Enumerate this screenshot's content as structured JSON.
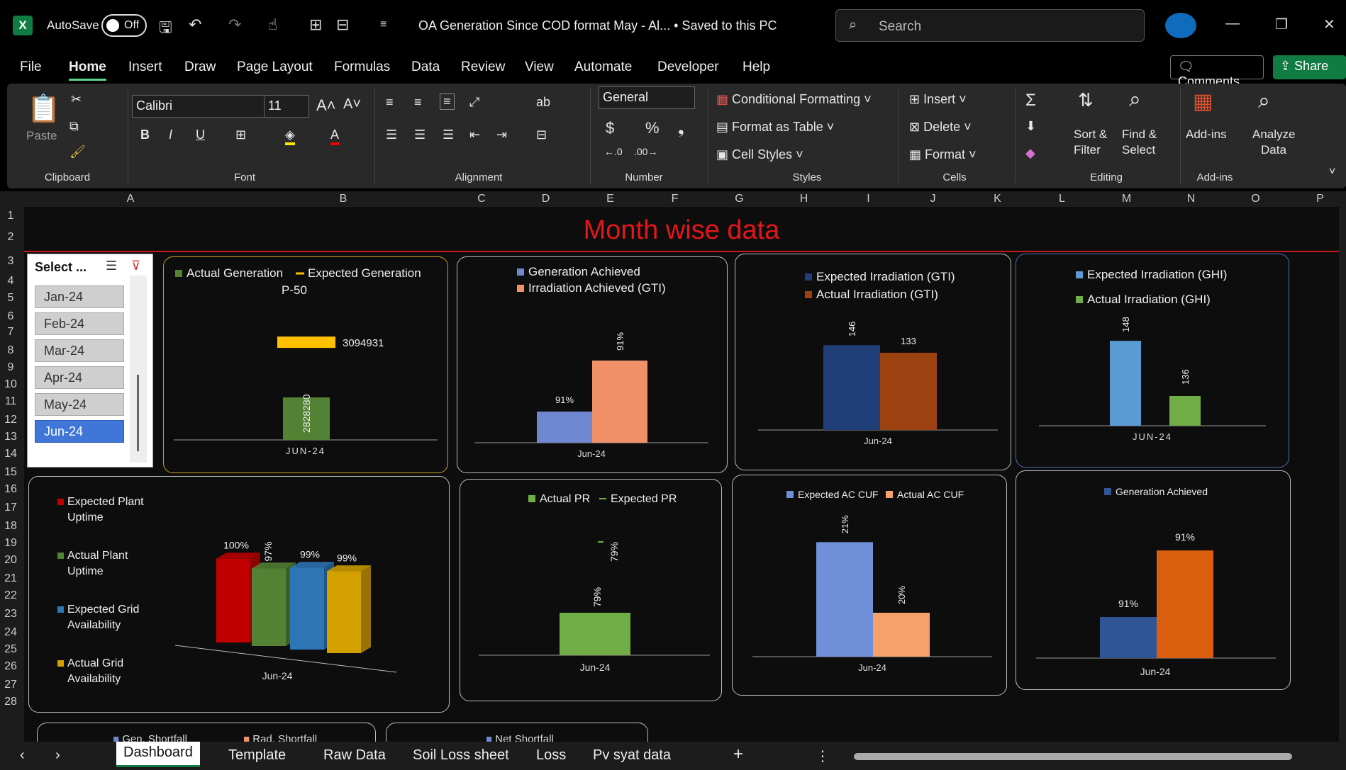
{
  "app": {
    "logo": "X",
    "autosave_label": "AutoSave",
    "autosave_state": "Off",
    "doc_title": "OA Generation Since COD  format May - Al...  • Saved to this PC",
    "search_placeholder": "Search"
  },
  "menu": [
    "File",
    "Home",
    "Insert",
    "Draw",
    "Page Layout",
    "Formulas",
    "Data",
    "Review",
    "View",
    "Automate",
    "Developer",
    "Help"
  ],
  "menu_active": "Home",
  "buttons": {
    "comments": "Comments",
    "share": "Share"
  },
  "ribbon": {
    "clipboard": {
      "label": "Clipboard",
      "paste": "Paste"
    },
    "font": {
      "label": "Font",
      "name": "Calibri",
      "size": "11"
    },
    "alignment": {
      "label": "Alignment"
    },
    "number": {
      "label": "Number",
      "format": "General"
    },
    "styles": {
      "label": "Styles",
      "conditional": "Conditional Formatting",
      "format_table": "Format as Table",
      "cell_styles": "Cell Styles"
    },
    "cells": {
      "label": "Cells",
      "insert": "Insert",
      "delete": "Delete",
      "format": "Format"
    },
    "editing": {
      "label": "Editing",
      "sort": "Sort &",
      "sort2": "Filter",
      "find": "Find &",
      "find2": "Select"
    },
    "addins": {
      "label": "Add-ins",
      "addins_btn": "Add-ins",
      "analyze": "Analyze",
      "analyze2": "Data"
    }
  },
  "columns": [
    "A",
    "B",
    "C",
    "D",
    "E",
    "F",
    "G",
    "H",
    "I",
    "J",
    "K",
    "L",
    "M",
    "N",
    "O",
    "P"
  ],
  "rows": [
    "1",
    "2",
    "3",
    "4",
    "5",
    "6",
    "7",
    "8",
    "9",
    "10",
    "11",
    "12",
    "13",
    "14",
    "15",
    "16",
    "17",
    "18",
    "19",
    "20",
    "21",
    "22",
    "23",
    "24",
    "25",
    "26",
    "27",
    "28"
  ],
  "dashboard": {
    "title": "Month wise data"
  },
  "slicer": {
    "title": "Select ...",
    "items": [
      "Jan-24",
      "Feb-24",
      "Mar-24",
      "Apr-24",
      "May-24",
      "Jun-24"
    ],
    "selected": "Jun-24"
  },
  "chart_data": [
    {
      "type": "bar",
      "legend": [
        "Actual Generation",
        "Expected Generation P-50"
      ],
      "categories": [
        "JUN-24"
      ],
      "series": [
        {
          "name": "Actual Generation",
          "values": [
            2828280
          ],
          "color": "#548235"
        },
        {
          "name": "Expected Generation P-50",
          "values": [
            3094931
          ],
          "color": "#ffc000"
        }
      ]
    },
    {
      "type": "bar",
      "legend": [
        "Generation Achieved",
        "Irradiation Achieved (GTI)"
      ],
      "categories": [
        "Jun-24"
      ],
      "series": [
        {
          "name": "Generation Achieved",
          "values": [
            91
          ],
          "color": "#6f87d0"
        },
        {
          "name": "Irradiation Achieved (GTI)",
          "values": [
            91
          ],
          "color": "#f0916a"
        }
      ],
      "unit": "%"
    },
    {
      "type": "bar",
      "legend": [
        "Expected Irradiation (GTI)",
        "Actual Irradiation (GTI)"
      ],
      "categories": [
        "Jun-24"
      ],
      "series": [
        {
          "name": "Expected Irradiation (GTI)",
          "values": [
            146
          ],
          "color": "#203e78"
        },
        {
          "name": "Actual Irradiation (GTI)",
          "values": [
            133
          ],
          "color": "#9c4210"
        }
      ]
    },
    {
      "type": "bar",
      "legend": [
        "Expected Irradiation (GHI)",
        "Actual Irradiation (GHI)"
      ],
      "categories": [
        "JUN-24"
      ],
      "series": [
        {
          "name": "Expected Irradiation (GHI)",
          "values": [
            148
          ],
          "color": "#5b9bd5"
        },
        {
          "name": "Actual Irradiation (GHI)",
          "values": [
            136
          ],
          "color": "#70ad47"
        }
      ]
    },
    {
      "type": "bar",
      "legend": [
        "Expected Plant Uptime",
        "Actual Plant Uptime",
        "Expected Grid Availability",
        "Actual Grid Availability"
      ],
      "categories": [
        "Jun-24"
      ],
      "series": [
        {
          "name": "Expected Plant Uptime",
          "values": [
            100
          ],
          "color": "#c00000"
        },
        {
          "name": "Actual Plant Uptime",
          "values": [
            97
          ],
          "color": "#548235"
        },
        {
          "name": "Expected Grid Availability",
          "values": [
            99
          ],
          "color": "#2e75b6"
        },
        {
          "name": "Actual Grid Availability",
          "values": [
            99
          ],
          "color": "#d4a000"
        }
      ],
      "unit": "%"
    },
    {
      "type": "bar",
      "legend": [
        "Actual PR",
        "Expected PR"
      ],
      "categories": [
        "Jun-24"
      ],
      "series": [
        {
          "name": "Actual PR",
          "values": [
            79
          ],
          "color": "#70ad47"
        },
        {
          "name": "Expected PR",
          "values": [
            79
          ],
          "color": "#70ad47"
        }
      ],
      "unit": "%"
    },
    {
      "type": "bar",
      "legend": [
        "Expected AC CUF",
        "Actual AC CUF"
      ],
      "categories": [
        "Jun-24"
      ],
      "series": [
        {
          "name": "Expected AC CUF",
          "values": [
            21
          ],
          "color": "#6f8fd8"
        },
        {
          "name": "Actual AC CUF",
          "values": [
            20
          ],
          "color": "#f4a16b"
        }
      ],
      "unit": "%"
    },
    {
      "type": "bar",
      "legend": [
        "Generation Achieved"
      ],
      "categories": [
        "Jun-24"
      ],
      "series": [
        {
          "name": "Generation Achieved",
          "values": [
            91,
            91
          ],
          "color": "#2f5597"
        }
      ],
      "bar_colors": [
        "#2f5597",
        "#d95f0e"
      ],
      "unit": "%"
    }
  ],
  "partial_legends": [
    "Gen. Shortfall",
    "Rad. Shortfall",
    "Net Shortfall"
  ],
  "tabs": [
    "Dashboard",
    "Template",
    "Raw Data",
    "Soil Loss sheet",
    "Loss",
    "Pv syat data"
  ],
  "active_tab": "Dashboard"
}
